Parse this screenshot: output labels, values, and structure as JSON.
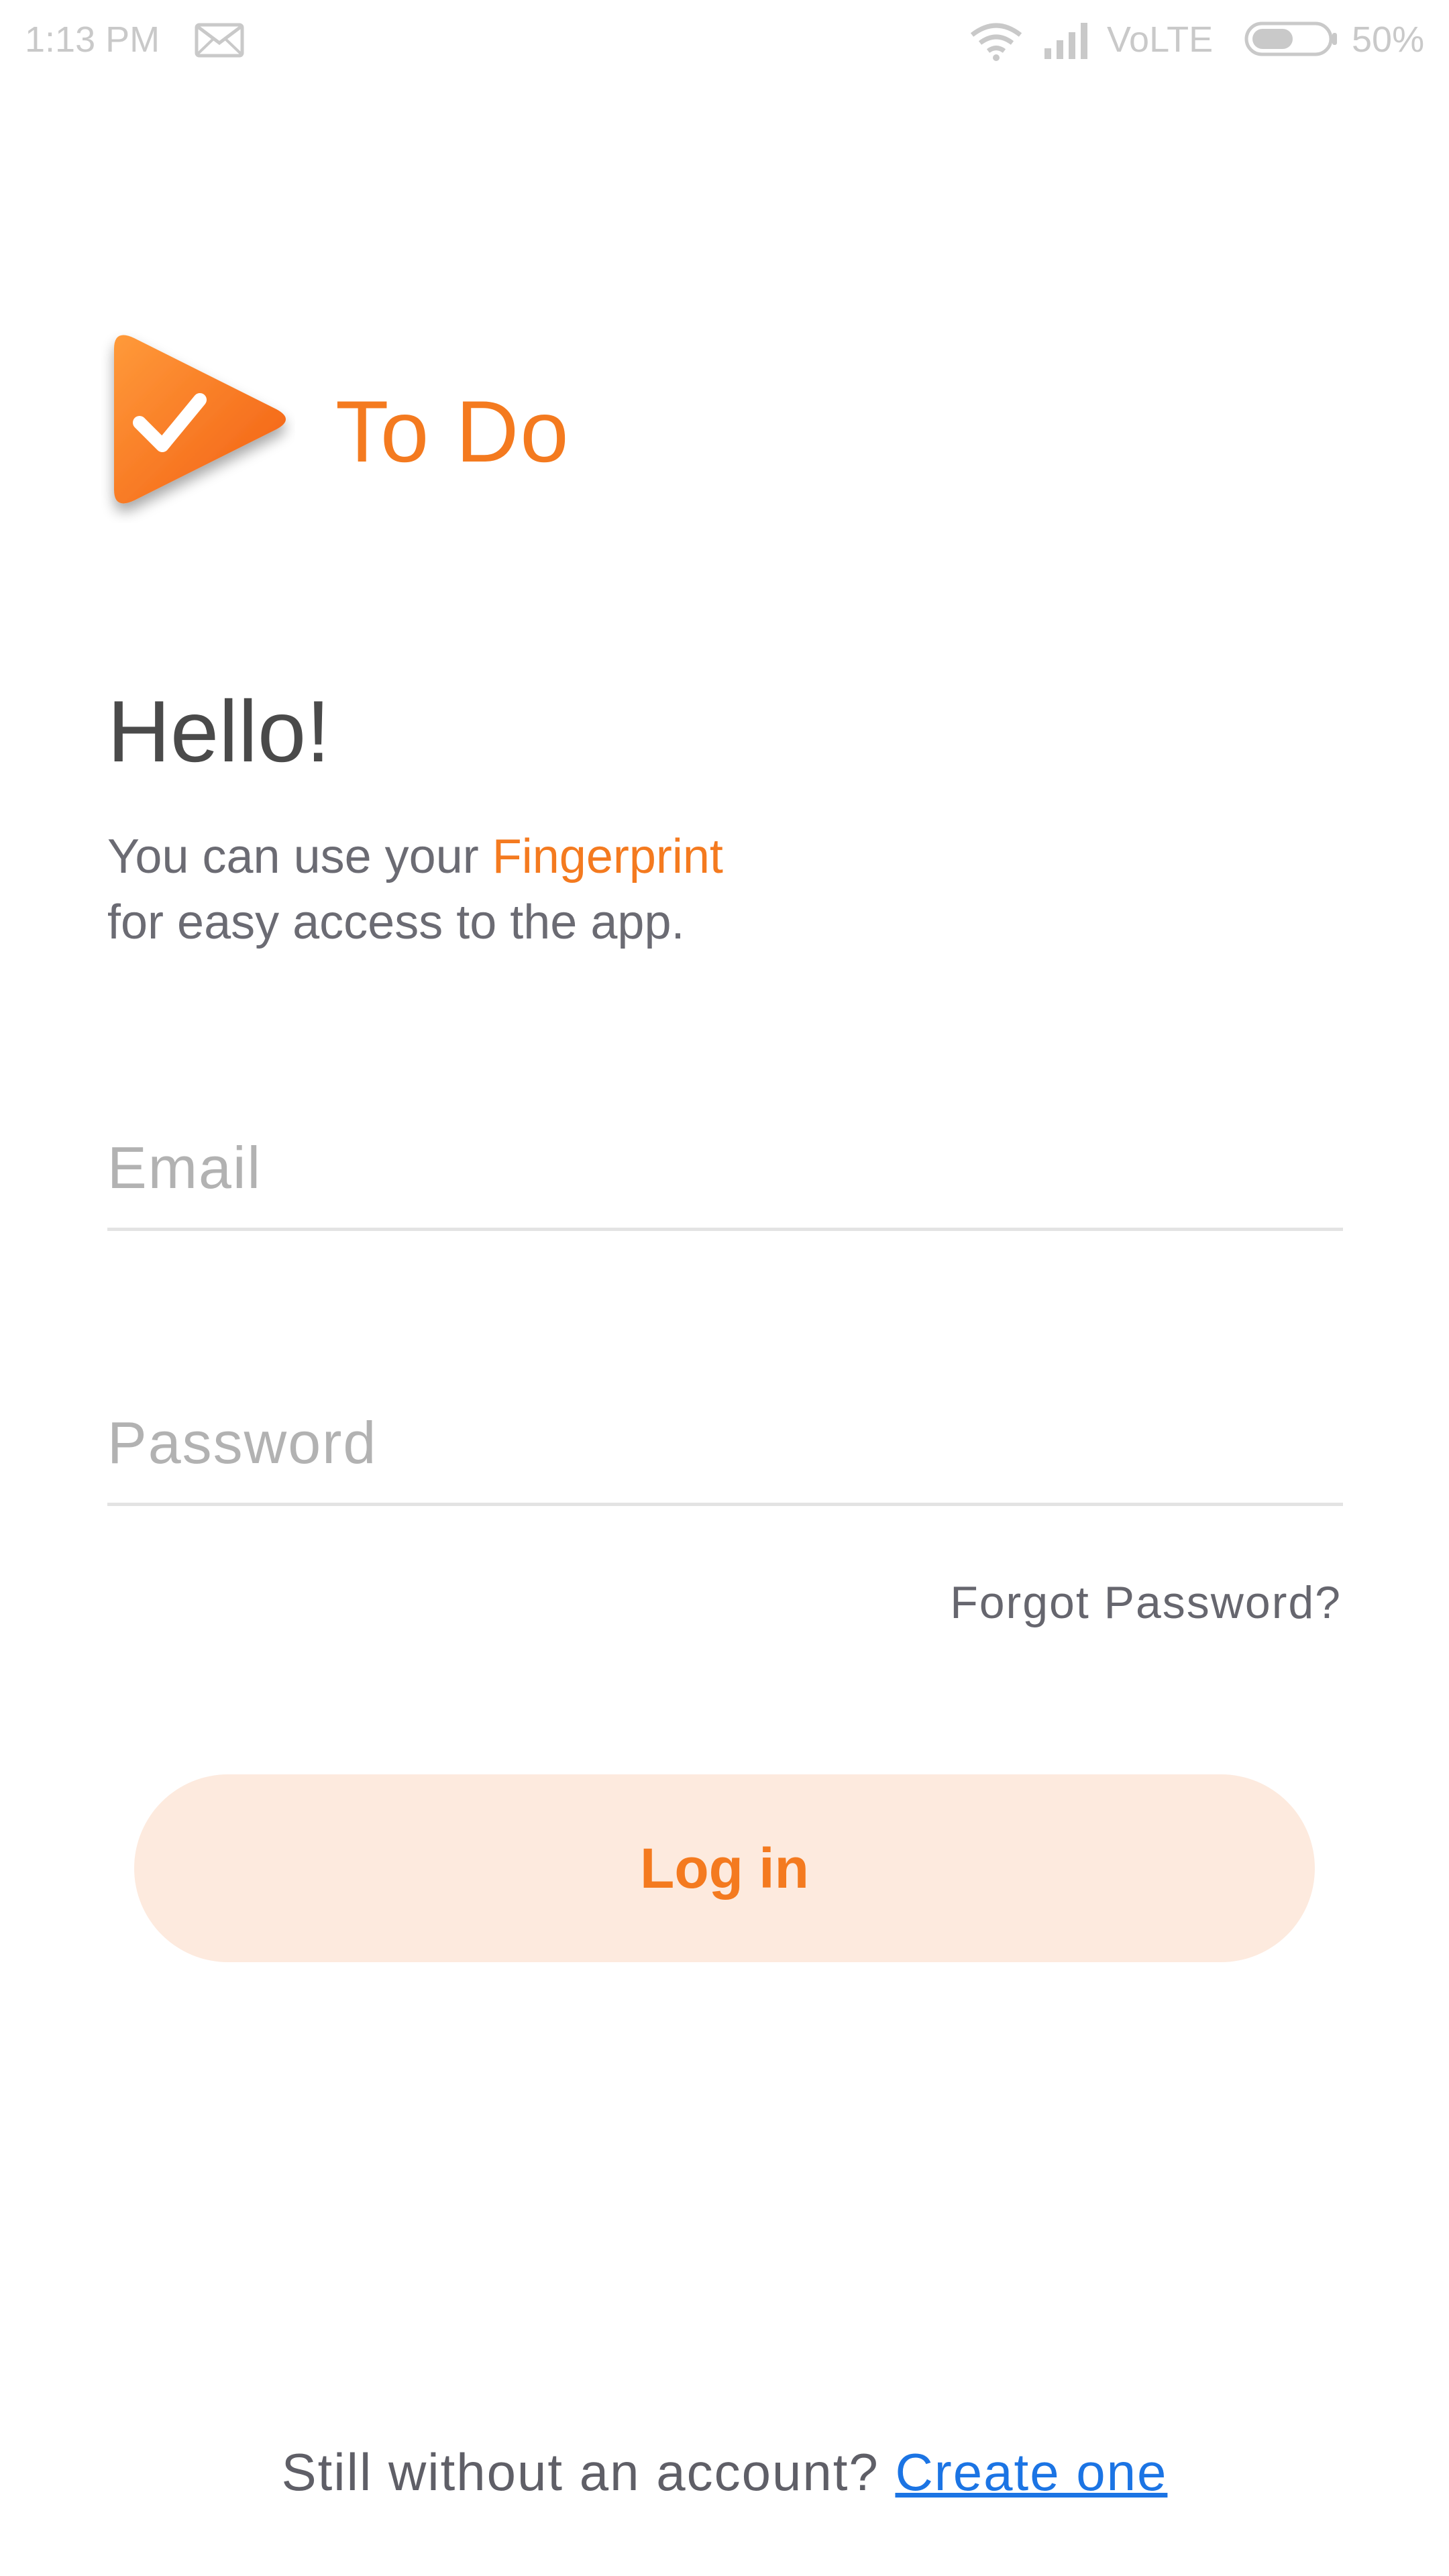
{
  "status_bar": {
    "time": "1:13 PM",
    "network": "VoLTE",
    "battery": "50%",
    "icons": [
      "mail-icon",
      "wifi-icon",
      "signal-icon",
      "battery-icon"
    ]
  },
  "brand": {
    "app_name": "To Do",
    "logo_icon": "check-play-logo",
    "accent_color": "#f47a1f"
  },
  "greeting": {
    "title": "Hello!",
    "line1_prefix": "You can use your ",
    "line1_highlight": "Fingerprint",
    "line2": "for easy access to the app."
  },
  "form": {
    "email_placeholder": "Email",
    "email_value": "",
    "password_placeholder": "Password",
    "password_value": "",
    "forgot_label": "Forgot Password?",
    "login_label": "Log in"
  },
  "footer": {
    "prompt": "Still without an account? ",
    "link_label": "Create one"
  }
}
